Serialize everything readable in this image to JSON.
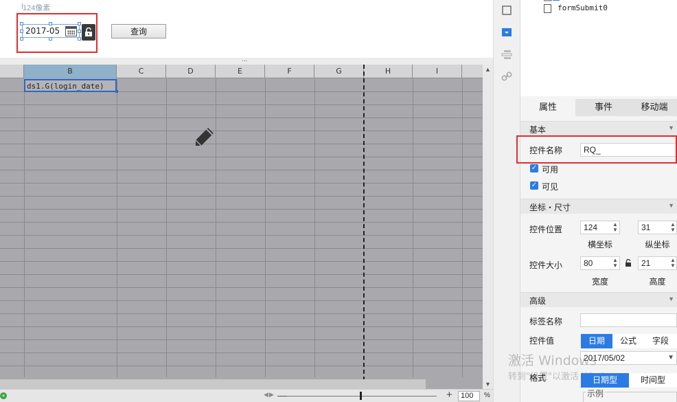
{
  "form": {
    "hint": "124像素",
    "date_value": "2017-05",
    "query_label": "查询",
    "splitter_glyph": "..."
  },
  "sheet": {
    "columns": [
      "B",
      "C",
      "D",
      "E",
      "F",
      "G",
      "H",
      "I"
    ],
    "cell_b1": "ds1.G(login_date)",
    "zoom_value": "100",
    "zoom_unit": "%",
    "zoom_minus": "—",
    "zoom_plus": "+"
  },
  "tree": {
    "item": "formSubmit0"
  },
  "panel": {
    "tabs": [
      "属性",
      "事件",
      "移动端"
    ],
    "sections": {
      "basic": "基本",
      "position_size": "坐标・尺寸",
      "advanced": "高级"
    },
    "control_name_label": "控件名称",
    "control_name_value": "RQ_",
    "enabled_label": "可用",
    "visible_label": "可见",
    "position_label": "控件位置",
    "x_value": "124",
    "y_value": "31",
    "x_label": "横坐标",
    "y_label": "纵坐标",
    "size_label": "控件大小",
    "width_value": "80",
    "height_value": "21",
    "width_label": "宽度",
    "height_label": "高度",
    "tag_name_label": "标签名称",
    "tag_name_value": "",
    "control_value_label": "控件值",
    "value_types": [
      "日期",
      "公式",
      "字段"
    ],
    "date_value": "2017/05/02",
    "format_label": "格式",
    "format_types": [
      "日期型",
      "时间型"
    ],
    "example_label": "示例"
  },
  "watermark": {
    "line1": "激活 Windows",
    "line2": "转到\"设置\"以激活 Windows"
  },
  "colors": {
    "accent": "#2c7be5",
    "highlight_box": "#e02d2d",
    "sheet_bg": "#a9a8ad"
  }
}
